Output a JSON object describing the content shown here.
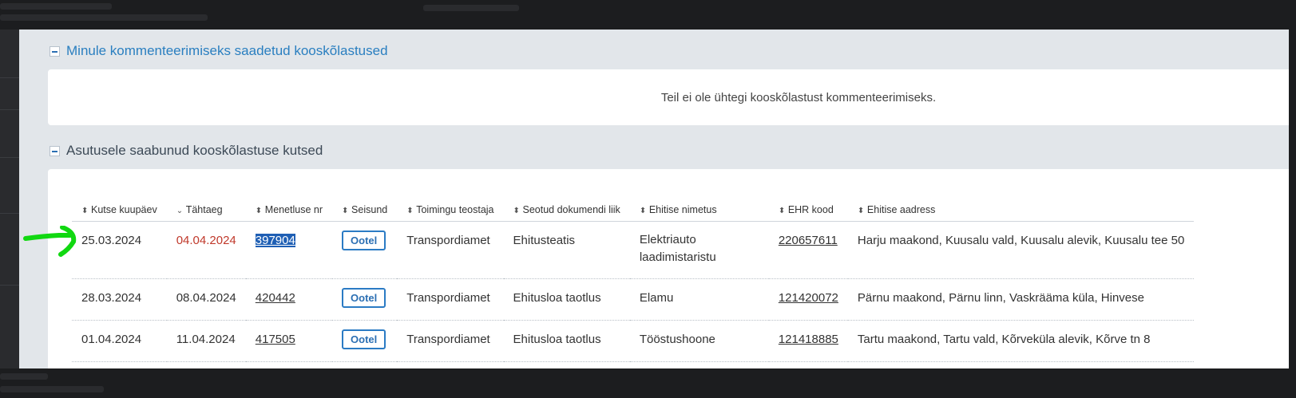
{
  "section_comment": {
    "title": "Minule kommenteerimiseks saadetud kooskõlastused",
    "empty_message": "Teil ei ole ühtegi kooskõlastust kommenteerimiseks."
  },
  "section_invites": {
    "title": "Asutusele saabunud kooskõlastuse kutsed",
    "columns": [
      {
        "label": "Kutse kuupäev",
        "sort_icon": "sort-both-icon"
      },
      {
        "label": "Tähtaeg",
        "sort_icon": "sort-desc-icon"
      },
      {
        "label": "Menetluse nr",
        "sort_icon": "sort-both-icon"
      },
      {
        "label": "Seisund",
        "sort_icon": "sort-both-icon"
      },
      {
        "label": "Toimingu teostaja",
        "sort_icon": "sort-both-icon"
      },
      {
        "label": "Seotud dokumendi liik",
        "sort_icon": "sort-both-icon"
      },
      {
        "label": "Ehitise nimetus",
        "sort_icon": "sort-both-icon"
      },
      {
        "label": "EHR kood",
        "sort_icon": "sort-both-icon"
      },
      {
        "label": "Ehitise aadress",
        "sort_icon": "sort-both-icon"
      }
    ],
    "rows": [
      {
        "invite_date": "25.03.2024",
        "deadline": "04.04.2024",
        "deadline_overdue": true,
        "proceeding_no": "397904",
        "status": "Ootel",
        "performer": "Transpordiamet",
        "doc_type": "Ehitusteatis",
        "building_name": "Elektriauto laadimistaristu",
        "ehr_code": "220657611",
        "address": "Harju maakond, Kuusalu vald, Kuusalu alevik, Kuusalu tee 50"
      },
      {
        "invite_date": "28.03.2024",
        "deadline": "08.04.2024",
        "deadline_overdue": false,
        "proceeding_no": "420442",
        "status": "Ootel",
        "performer": "Transpordiamet",
        "doc_type": "Ehitusloa taotlus",
        "building_name": "Elamu",
        "ehr_code": "121420072",
        "address": "Pärnu maakond, Pärnu linn, Vaskrääma küla, Hinvese"
      },
      {
        "invite_date": "01.04.2024",
        "deadline": "11.04.2024",
        "deadline_overdue": false,
        "proceeding_no": "417505",
        "status": "Ootel",
        "performer": "Transpordiamet",
        "doc_type": "Ehitusloa taotlus",
        "building_name": "Tööstushoone",
        "ehr_code": "121418885",
        "address": "Tartu maakond, Tartu vald, Kõrveküla alevik, Kõrve tn 8"
      }
    ]
  },
  "colors": {
    "accent": "#2a7fc0",
    "overdue": "#c0392b",
    "annotation_arrow": "#11d811",
    "selection": "#1f5fb4"
  }
}
